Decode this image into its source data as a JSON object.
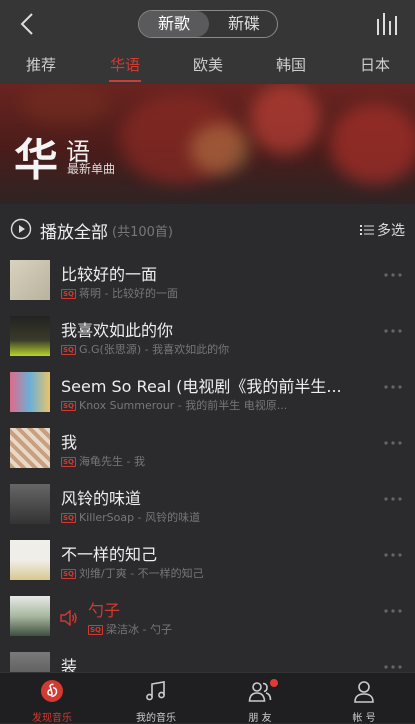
{
  "header": {
    "back_icon": "chevron-left-icon",
    "segments": [
      "新歌",
      "新碟"
    ],
    "chart_icon": "bar-chart-icon"
  },
  "tabs": [
    "推荐",
    "华语",
    "欧美",
    "韩国",
    "日本"
  ],
  "active_tab": "华语",
  "banner": {
    "title_big": "华",
    "title_small": "语",
    "subtitle": "最新单曲"
  },
  "playbar": {
    "label": "播放全部",
    "count": "(共100首)",
    "multi_select": "多选"
  },
  "songs": [
    {
      "title": "比较好的一面",
      "meta": "蒋明 - 比较好的一面"
    },
    {
      "title": "我喜欢如此的你",
      "meta": "G.G(张思源) - 我喜欢如此的你"
    },
    {
      "title": "Seem So Real (电视剧《我的前半生...",
      "meta": "Knox Summerour - 我的前半生 电视原..."
    },
    {
      "title": "我",
      "meta": "海龟先生 - 我"
    },
    {
      "title": "风铃的味道",
      "meta": "KillerSoap - 风铃的味道"
    },
    {
      "title": "不一样的知己",
      "meta": "刘维/丁爽 - 不一样的知己"
    },
    {
      "title": "勺子",
      "meta": "梁洁冰 - 勺子",
      "playing": true
    },
    {
      "title": "装",
      "meta": ""
    }
  ],
  "sq_badge": "SQ",
  "bottom_nav": [
    {
      "label": "发现音乐",
      "icon": "netease-logo-icon"
    },
    {
      "label": "我的音乐",
      "icon": "music-note-icon"
    },
    {
      "label": "朋 友",
      "icon": "friends-icon"
    },
    {
      "label": "帐 号",
      "icon": "account-icon"
    }
  ],
  "colors": {
    "accent": "#d33a31",
    "background": "#2b2b2d",
    "nav_bg": "#1f1f21"
  }
}
